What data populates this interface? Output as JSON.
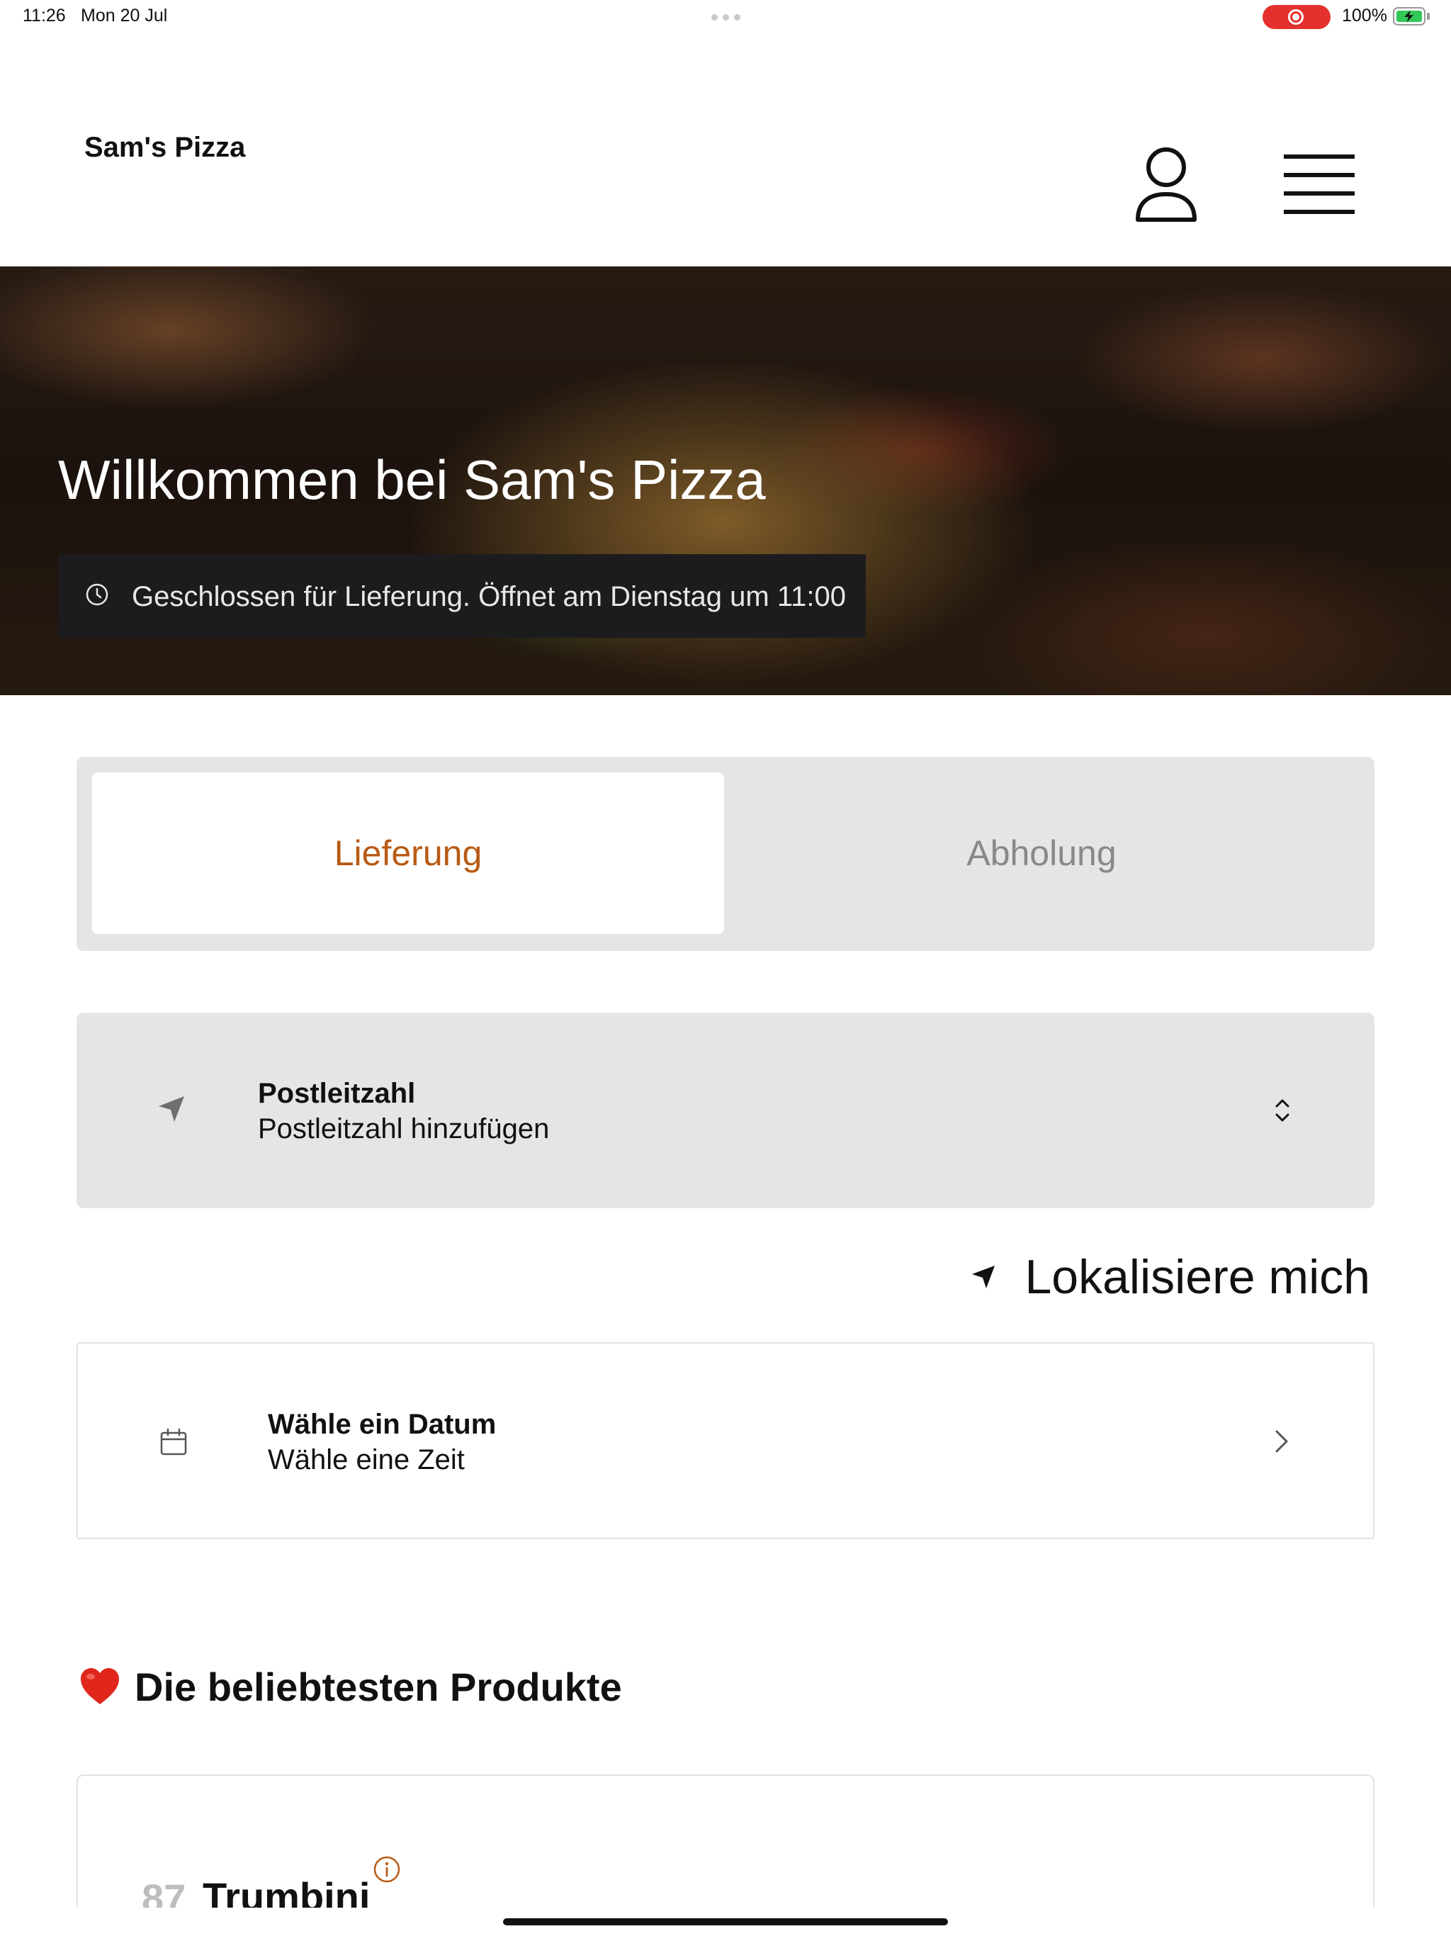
{
  "status_bar": {
    "time": "11:26",
    "date": "Mon 20 Jul",
    "battery_label": "100%",
    "battery_level": 1.0,
    "recording_color": "#e5312d",
    "battery_color": "#34c759"
  },
  "header": {
    "brand": "Sam's Pizza",
    "profile_icon": "person-icon",
    "menu_icon": "hamburger-menu-icon"
  },
  "hero": {
    "title": "Willkommen bei Sam's Pizza",
    "status_text": "Geschlossen für Lieferung. Öffnet am Dienstag um 11:00",
    "status_icon": "clock-icon"
  },
  "order_mode": {
    "tabs": [
      {
        "label": "Lieferung",
        "active": true
      },
      {
        "label": "Abholung",
        "active": false
      }
    ],
    "accent_color": "#b85a14"
  },
  "postal_code": {
    "label": "Postleitzahl",
    "value": "Postleitzahl hinzufügen",
    "icon": "location-arrow-icon",
    "chevron_icon": "chevron-up-down-icon"
  },
  "locate": {
    "label": "Lokalisiere mich",
    "icon": "location-arrow-icon"
  },
  "schedule": {
    "label": "Wähle ein Datum",
    "value": "Wähle eine Zeit",
    "icon": "calendar-icon",
    "arrow_icon": "chevron-right-icon"
  },
  "popular": {
    "title": "Die beliebtesten Produkte",
    "icon": "heart-icon",
    "products": [
      {
        "number": "87",
        "name": "Trumbini",
        "info_icon": "info-icon"
      }
    ]
  }
}
